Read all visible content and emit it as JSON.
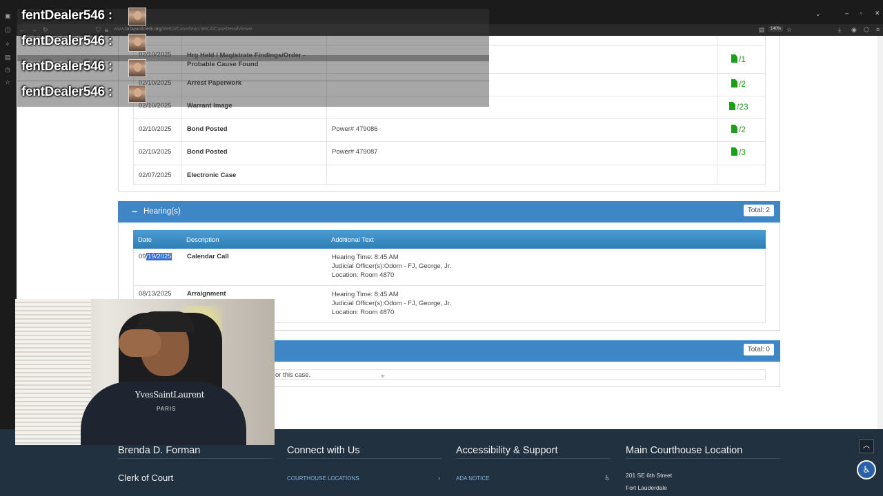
{
  "browser": {
    "url_domain": "browardclerk.org",
    "url_path": "/Web2/CaseSearchECA/CaseDetailViewer",
    "url_prefix": "www.",
    "zoom": "140%"
  },
  "chat_overlay": {
    "messages": [
      {
        "user": "fentDealer546 :"
      },
      {
        "user": "fentDealer546 :"
      },
      {
        "user": "fentDealer546 :"
      },
      {
        "user": "fentDealer546 :"
      }
    ]
  },
  "dockets": {
    "rows": [
      {
        "date": "02/10/2025",
        "description": "Hrg Held / Magistrate Findings/Order - Probable Cause Found",
        "additional": "",
        "doc_count": "/1"
      },
      {
        "date": "02/10/2025",
        "description": "Arrest Paperwork",
        "additional": "",
        "doc_count": "/2"
      },
      {
        "date": "02/10/2025",
        "description": "Warrant Image",
        "additional": "",
        "doc_count": "/23"
      },
      {
        "date": "02/10/2025",
        "description": "Bond Posted",
        "additional": "Power# 479086",
        "doc_count": "/2"
      },
      {
        "date": "02/10/2025",
        "description": "Bond Posted",
        "additional": "Power# 479087",
        "doc_count": "/3"
      },
      {
        "date": "02/07/2025",
        "description": "Electronic Case",
        "additional": "",
        "doc_count": ""
      }
    ]
  },
  "hearings": {
    "title": "Hearing(s)",
    "toggle": "−",
    "total": "Total: 2",
    "columns": [
      "Date",
      "Description",
      "Additional Text"
    ],
    "rows": [
      {
        "date_prefix": "09",
        "date_selected": "/19/2025",
        "description": "Calendar Call",
        "line1": "Hearing Time: 8:45 AM",
        "line2": "Judicial Officer(s):Odom - FJ, George, Jr.",
        "line3": "Location: Room 4870"
      },
      {
        "date": "08/13/2025",
        "description": "Arraignment",
        "line1": "Hearing Time: 8:45 AM",
        "line2": "Judicial Officer(s):Odom - FJ, George, Jr.",
        "line3": "Location: Room 4870"
      }
    ]
  },
  "next_section": {
    "total": "Total: 0",
    "empty_text": "or this case."
  },
  "webcam": {
    "shirt_brand": "YvesSaintLaurent",
    "shirt_sub": "PARIS"
  },
  "footer": {
    "col1": {
      "heading": "Brenda D. Forman",
      "sub": "Clerk of Court"
    },
    "col2": {
      "heading": "Connect with Us",
      "link": "COURTHOUSE LOCATIONS"
    },
    "col3": {
      "heading": "Accessibility & Support",
      "link": "ADA NOTICE"
    },
    "col4": {
      "heading": "Main Courthouse Location",
      "line1": "201 SE 6th Street",
      "line2": "Fort Lauderdale"
    }
  }
}
